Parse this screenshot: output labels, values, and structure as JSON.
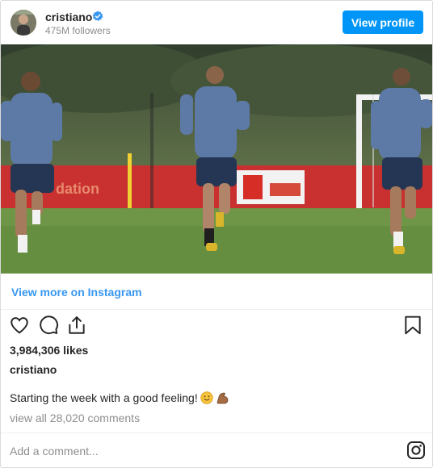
{
  "header": {
    "username": "cristiano",
    "followers": "475M followers",
    "view_profile_label": "View profile"
  },
  "photo": {
    "description": "three footballers jogging on a training pitch"
  },
  "view_more_label": "View more on Instagram",
  "post": {
    "likes": "3,984,306 likes",
    "caption_user": "cristiano",
    "caption_text": "Starting the week with a good feeling!",
    "caption_emojis": [
      "smiling-face",
      "flexed-biceps"
    ],
    "comments_link": "view all 28,020 comments"
  },
  "comment_box": {
    "placeholder": "Add a comment..."
  },
  "colors": {
    "accent": "#0095f6",
    "link": "#3897f0",
    "muted": "#8e8e8e",
    "text": "#262626"
  },
  "icons": [
    "verified-badge-icon",
    "heart-icon",
    "comment-icon",
    "share-icon",
    "bookmark-icon",
    "instagram-icon"
  ]
}
